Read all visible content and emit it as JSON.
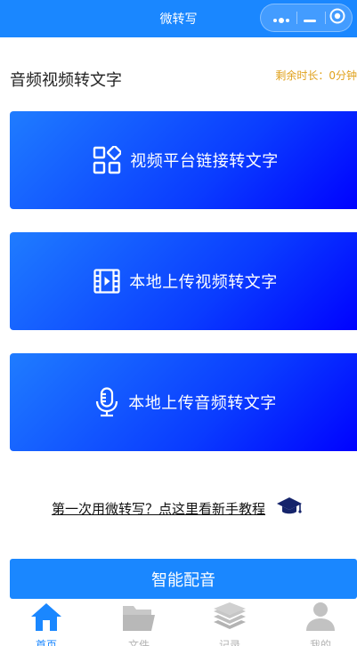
{
  "header": {
    "title": "微转写",
    "capsule": {
      "more_icon": "more-dots-icon",
      "minimize_icon": "minimize-icon",
      "close_icon": "target-close-icon"
    }
  },
  "section": {
    "title": "音频视频转文字",
    "remaining_label": "剩余时长：0分钟"
  },
  "cards": [
    {
      "label": "视频平台链接转文字",
      "icon": "grid-apps-icon"
    },
    {
      "label": "本地上传视频转文字",
      "icon": "film-icon"
    },
    {
      "label": "本地上传音频转文字",
      "icon": "microphone-icon"
    }
  ],
  "guide": {
    "text": "第一次用微转写？点这里看新手教程",
    "icon": "graduation-cap-icon"
  },
  "dub_button": {
    "label": "智能配音"
  },
  "tabbar": {
    "items": [
      {
        "label": "首页",
        "icon": "home-icon",
        "active": true
      },
      {
        "label": "文件",
        "icon": "folder-icon",
        "active": false
      },
      {
        "label": "记录",
        "icon": "layers-icon",
        "active": false
      },
      {
        "label": "我的",
        "icon": "user-icon",
        "active": false
      }
    ]
  },
  "colors": {
    "primary": "#1a87ff",
    "card_gradient_end": "#0000ff",
    "accent_orange": "#e0a11b",
    "inactive": "#b3b3b3"
  }
}
